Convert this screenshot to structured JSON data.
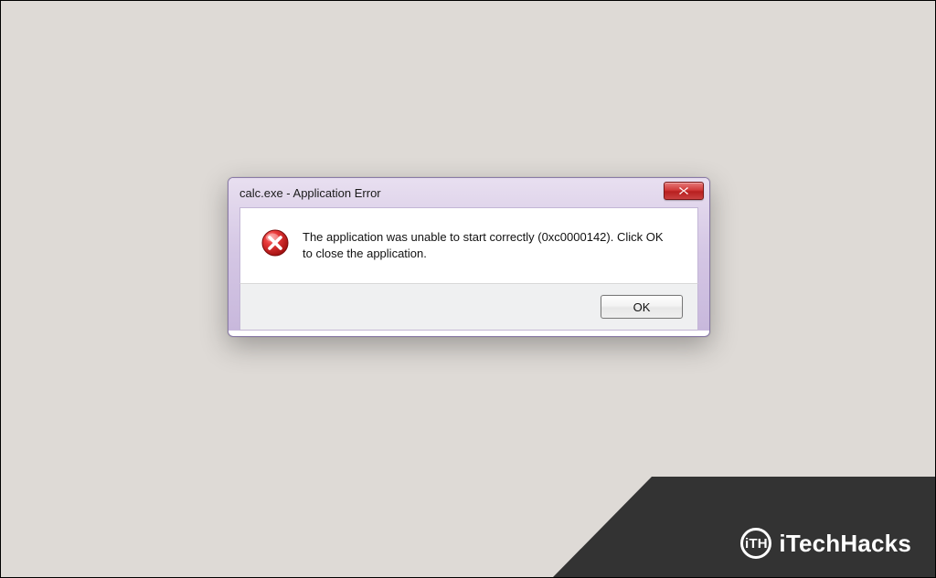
{
  "dialog": {
    "title": "calc.exe - Application Error",
    "message": "The application was unable to start correctly (0xc0000142). Click OK to close the application.",
    "ok_label": "OK",
    "close_label": "Close",
    "icon": "error-icon",
    "colors": {
      "titlebar_gradient_top": "#e8dff0",
      "titlebar_gradient_bottom": "#c8b8dc",
      "close_button": "#c83434",
      "border": "#8a7aa8"
    }
  },
  "watermark": {
    "logo_abbrev": "iTH",
    "brand": "iTechHacks",
    "bg_color": "#333333"
  }
}
